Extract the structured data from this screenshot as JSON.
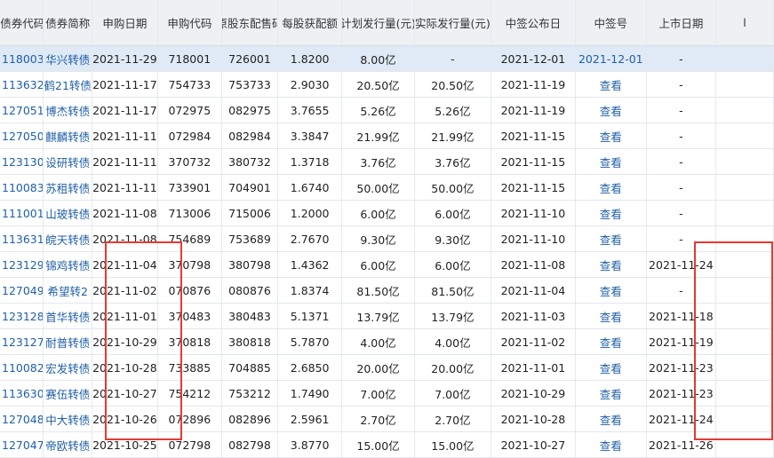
{
  "headers": [
    "债券代码",
    "债券简称",
    "申购日期",
    "申购代码",
    "原股东配售码",
    "每股获配额",
    "计划发行量(元)",
    "实际发行量(元)",
    "中签公布日",
    "中签号",
    "上市日期",
    "l"
  ],
  "rows": [
    [
      "118003",
      "华兴转债",
      "2021-11-29",
      "718001",
      "726001",
      "1.8200",
      "8.00亿",
      "-",
      "2021-12-01",
      "2021-12-01",
      "-"
    ],
    [
      "113632",
      "鹤21转债",
      "2021-11-17",
      "754733",
      "753733",
      "2.9030",
      "20.50亿",
      "20.50亿",
      "2021-11-19",
      "查看",
      "-"
    ],
    [
      "127051",
      "博杰转债",
      "2021-11-17",
      "072975",
      "082975",
      "3.7655",
      "5.26亿",
      "5.26亿",
      "2021-11-19",
      "查看",
      "-"
    ],
    [
      "127050",
      "麒麟转债",
      "2021-11-11",
      "072984",
      "082984",
      "3.3847",
      "21.99亿",
      "21.99亿",
      "2021-11-15",
      "查看",
      "-"
    ],
    [
      "123130",
      "设研转债",
      "2021-11-11",
      "370732",
      "380732",
      "1.3718",
      "3.76亿",
      "3.76亿",
      "2021-11-15",
      "查看",
      "-"
    ],
    [
      "110083",
      "苏租转债",
      "2021-11-11",
      "733901",
      "704901",
      "1.6740",
      "50.00亿",
      "50.00亿",
      "2021-11-15",
      "查看",
      "-"
    ],
    [
      "111001",
      "山玻转债",
      "2021-11-08",
      "713006",
      "715006",
      "1.2000",
      "6.00亿",
      "6.00亿",
      "2021-11-10",
      "查看",
      "-"
    ],
    [
      "113631",
      "皖天转债",
      "2021-11-08",
      "754689",
      "753689",
      "2.7670",
      "9.30亿",
      "9.30亿",
      "2021-11-10",
      "查看",
      "-"
    ],
    [
      "123129",
      "锦鸡转债",
      "2021-11-04",
      "370798",
      "380798",
      "1.4362",
      "6.00亿",
      "6.00亿",
      "2021-11-08",
      "查看",
      "2021-11-24"
    ],
    [
      "127049",
      "希望转2",
      "2021-11-02",
      "070876",
      "080876",
      "1.8374",
      "81.50亿",
      "81.50亿",
      "2021-11-04",
      "查看",
      "-"
    ],
    [
      "123128",
      "首华转债",
      "2021-11-01",
      "370483",
      "380483",
      "5.1371",
      "13.79亿",
      "13.79亿",
      "2021-11-03",
      "查看",
      "2021-11-18"
    ],
    [
      "123127",
      "耐普转债",
      "2021-10-29",
      "370818",
      "380818",
      "5.7870",
      "4.00亿",
      "4.00亿",
      "2021-11-02",
      "查看",
      "2021-11-19"
    ],
    [
      "110082",
      "宏发转债",
      "2021-10-28",
      "733885",
      "704885",
      "2.6850",
      "20.00亿",
      "20.00亿",
      "2021-11-01",
      "查看",
      "2021-11-23"
    ],
    [
      "113630",
      "赛伍转债",
      "2021-10-27",
      "754212",
      "753212",
      "1.7490",
      "7.00亿",
      "7.00亿",
      "2021-10-29",
      "查看",
      "2021-11-23"
    ],
    [
      "127048",
      "中大转债",
      "2021-10-26",
      "072896",
      "082896",
      "2.5961",
      "2.70亿",
      "2.70亿",
      "2021-10-28",
      "查看",
      "2021-11-24"
    ],
    [
      "127047",
      "帝欧转债",
      "2021-10-25",
      "072798",
      "082798",
      "3.8770",
      "15.00亿",
      "15.00亿",
      "2021-10-27",
      "查看",
      "2021-11-26"
    ]
  ],
  "colors": {
    "link": "#1f5fa8",
    "highlight": "#e53935",
    "header_bg": "#eef1f4",
    "selected_row": "#dfeaf6"
  }
}
